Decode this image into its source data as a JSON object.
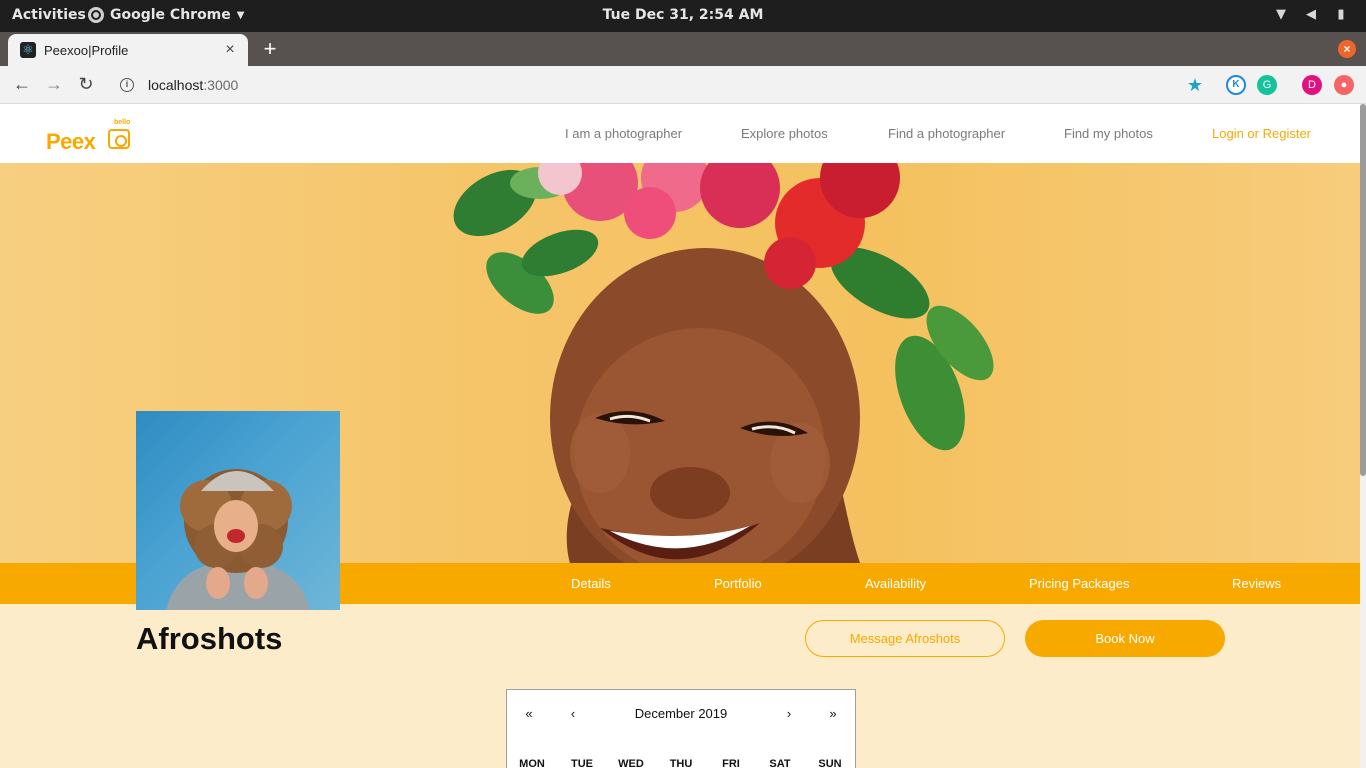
{
  "os": {
    "activities": "Activities",
    "app_name": "Google Chrome",
    "clock": "Tue Dec 31,  2:54 AM"
  },
  "browser": {
    "tab_title": "Peexoo|Profile",
    "url_host": "localhost",
    "url_port": ":3000",
    "profile_initial": "D"
  },
  "site": {
    "logo": {
      "word": "Peex",
      "tag": "bello"
    },
    "nav": [
      "I am a photographer",
      "Explore photos",
      "Find a photographer",
      "Find my photos",
      "Login or Register"
    ]
  },
  "profile": {
    "tabs": [
      "Details",
      "Portfolio",
      "Availability",
      "Pricing Packages",
      "Reviews"
    ],
    "name": "Afroshots",
    "message_button": "Message Afroshots",
    "book_button": "Book Now"
  },
  "calendar": {
    "prev_year": "«",
    "prev_month": "‹",
    "label": "December 2019",
    "next_month": "›",
    "next_year": "»",
    "weekdays": [
      "MON",
      "TUE",
      "WED",
      "THU",
      "FRI",
      "SAT",
      "SUN"
    ]
  },
  "colors": {
    "brand": "#f8a900",
    "page_bg": "#fcecc9",
    "hero_bg": "#f6c56a"
  }
}
